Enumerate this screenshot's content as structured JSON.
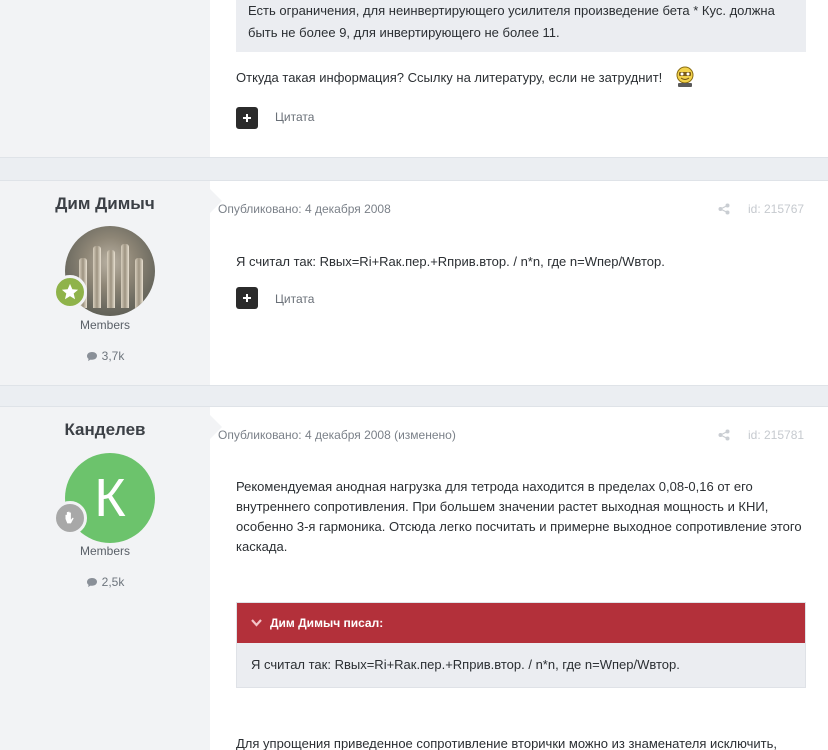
{
  "posts": [
    {
      "quote_text": "Есть ограничения, для неинвертирующего усилителя произведение бета * Кус. должна быть не более 9, для инвертирующего не более 11.",
      "text": "Откуда такая информация? Ссылку на литературу, если не затруднит!",
      "quote_button_label": "Цитата"
    },
    {
      "author": "Дим Димыч",
      "role": "Members",
      "post_count": "3,7k",
      "published": "Опубликовано: 4 декабря 2008",
      "post_id": "id: 215767",
      "text": "Я считал так: Rвых=Ri+Rак.пер.+Rприв.втор. / n*n, где n=Wпер/Wвтор.",
      "quote_button_label": "Цитата"
    },
    {
      "author": "Канделев",
      "avatar_letter": "К",
      "role": "Members",
      "post_count": "2,5k",
      "published": "Опубликовано: 4 декабря 2008 (изменено)",
      "post_id": "id: 215781",
      "text": "Рекомендуемая анодная нагрузка для тетрода находится в пределах 0,08-0,16 от его внутреннего сопротивления. При большем значении растет выходная мощность и КНИ, особенно 3-я гармоника. Отсюда легко посчитать и примерне выходное сопротивление этого каскада.",
      "quote_author": "Дим Димыч писал:",
      "quote_text": "Я считал так: Rвых=Ri+Rак.пер.+Rприв.втор. / n*n, где n=Wпер/Wвтор.",
      "text2": "Для упрощения приведенное сопротивление вторички можно из знаменателя исключить,"
    }
  ],
  "colors": {
    "quote_header": "#b3303a",
    "avatar_green": "#6cc36c",
    "badge_star": "#8fb34a"
  }
}
